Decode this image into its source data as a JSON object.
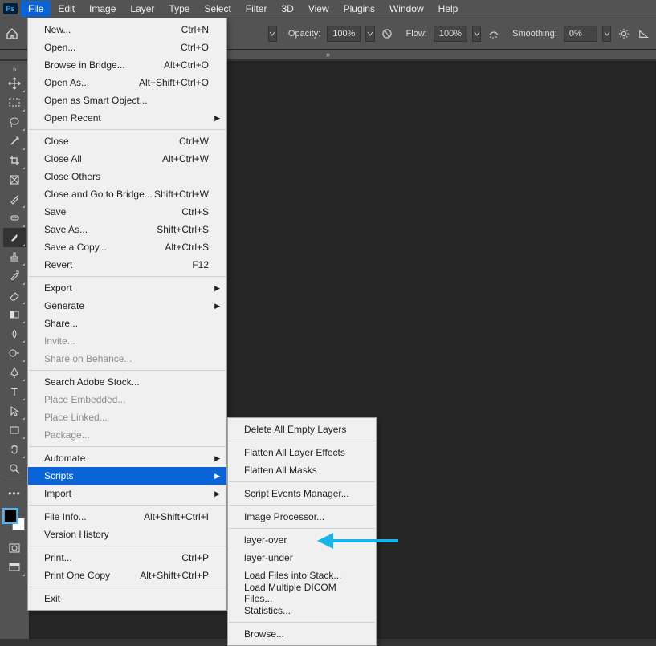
{
  "menubar": [
    "File",
    "Edit",
    "Image",
    "Layer",
    "Type",
    "Select",
    "Filter",
    "3D",
    "View",
    "Plugins",
    "Window",
    "Help"
  ],
  "options": {
    "opacity_label": "Opacity:",
    "opacity_value": "100%",
    "flow_label": "Flow:",
    "flow_value": "100%",
    "smoothing_label": "Smoothing:",
    "smoothing_value": "0%"
  },
  "file_menu": [
    {
      "t": "row",
      "label": "New...",
      "sc": "Ctrl+N"
    },
    {
      "t": "row",
      "label": "Open...",
      "sc": "Ctrl+O"
    },
    {
      "t": "row",
      "label": "Browse in Bridge...",
      "sc": "Alt+Ctrl+O"
    },
    {
      "t": "row",
      "label": "Open As...",
      "sc": "Alt+Shift+Ctrl+O"
    },
    {
      "t": "row",
      "label": "Open as Smart Object..."
    },
    {
      "t": "row",
      "label": "Open Recent",
      "sub": true
    },
    {
      "t": "sep"
    },
    {
      "t": "row",
      "label": "Close",
      "sc": "Ctrl+W"
    },
    {
      "t": "row",
      "label": "Close All",
      "sc": "Alt+Ctrl+W"
    },
    {
      "t": "row",
      "label": "Close Others"
    },
    {
      "t": "row",
      "label": "Close and Go to Bridge...",
      "sc": "Shift+Ctrl+W"
    },
    {
      "t": "row",
      "label": "Save",
      "sc": "Ctrl+S"
    },
    {
      "t": "row",
      "label": "Save As...",
      "sc": "Shift+Ctrl+S"
    },
    {
      "t": "row",
      "label": "Save a Copy...",
      "sc": "Alt+Ctrl+S"
    },
    {
      "t": "row",
      "label": "Revert",
      "sc": "F12"
    },
    {
      "t": "sep"
    },
    {
      "t": "row",
      "label": "Export",
      "sub": true
    },
    {
      "t": "row",
      "label": "Generate",
      "sub": true
    },
    {
      "t": "row",
      "label": "Share..."
    },
    {
      "t": "row",
      "label": "Invite...",
      "disabled": true
    },
    {
      "t": "row",
      "label": "Share on Behance...",
      "disabled": true
    },
    {
      "t": "sep"
    },
    {
      "t": "row",
      "label": "Search Adobe Stock..."
    },
    {
      "t": "row",
      "label": "Place Embedded...",
      "disabled": true
    },
    {
      "t": "row",
      "label": "Place Linked...",
      "disabled": true
    },
    {
      "t": "row",
      "label": "Package...",
      "disabled": true
    },
    {
      "t": "sep"
    },
    {
      "t": "row",
      "label": "Automate",
      "sub": true
    },
    {
      "t": "row",
      "label": "Scripts",
      "sub": true,
      "hl": true
    },
    {
      "t": "row",
      "label": "Import",
      "sub": true
    },
    {
      "t": "sep"
    },
    {
      "t": "row",
      "label": "File Info...",
      "sc": "Alt+Shift+Ctrl+I"
    },
    {
      "t": "row",
      "label": "Version History"
    },
    {
      "t": "sep"
    },
    {
      "t": "row",
      "label": "Print...",
      "sc": "Ctrl+P"
    },
    {
      "t": "row",
      "label": "Print One Copy",
      "sc": "Alt+Shift+Ctrl+P"
    },
    {
      "t": "sep"
    },
    {
      "t": "row",
      "label": "Exit"
    }
  ],
  "scripts_menu": [
    {
      "t": "row",
      "label": "Delete All Empty Layers"
    },
    {
      "t": "sep"
    },
    {
      "t": "row",
      "label": "Flatten All Layer Effects"
    },
    {
      "t": "row",
      "label": "Flatten All Masks"
    },
    {
      "t": "sep"
    },
    {
      "t": "row",
      "label": "Script Events Manager..."
    },
    {
      "t": "sep"
    },
    {
      "t": "row",
      "label": "Image Processor..."
    },
    {
      "t": "sep"
    },
    {
      "t": "row",
      "label": "layer-over"
    },
    {
      "t": "row",
      "label": "layer-under"
    },
    {
      "t": "row",
      "label": "Load Files into Stack..."
    },
    {
      "t": "row",
      "label": "Load Multiple DICOM Files..."
    },
    {
      "t": "row",
      "label": "Statistics..."
    },
    {
      "t": "sep"
    },
    {
      "t": "row",
      "label": "Browse..."
    }
  ]
}
